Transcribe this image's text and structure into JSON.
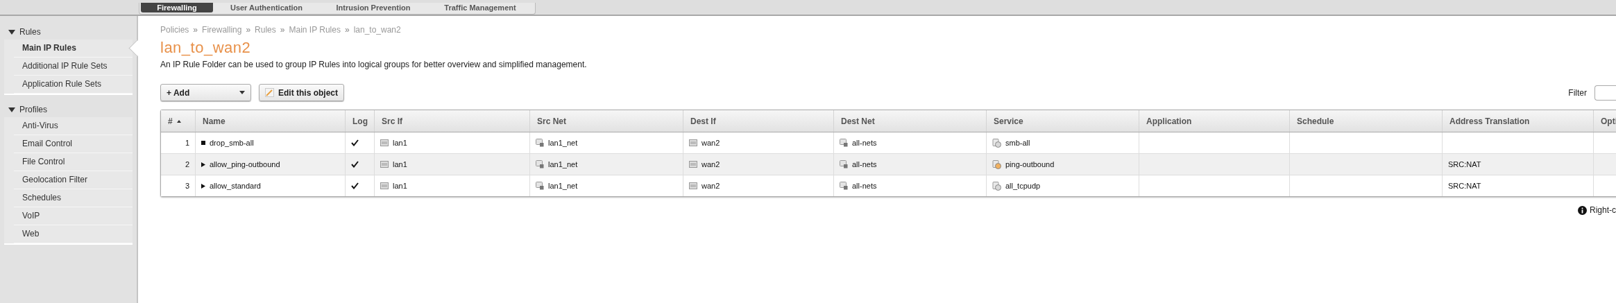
{
  "top_tabs": [
    {
      "label": "Firewalling",
      "selected": true
    },
    {
      "label": "User Authentication",
      "selected": false
    },
    {
      "label": "Intrusion Prevention",
      "selected": false
    },
    {
      "label": "Traffic Management",
      "selected": false
    }
  ],
  "sidebar": {
    "sections": [
      {
        "title": "Rules",
        "expanded": true,
        "items": [
          {
            "label": "Main IP Rules",
            "selected": true
          },
          {
            "label": "Additional IP Rule Sets",
            "selected": false
          },
          {
            "label": "Application Rule Sets",
            "selected": false
          }
        ]
      },
      {
        "title": "Profiles",
        "expanded": true,
        "items": [
          {
            "label": "Anti-Virus",
            "selected": false
          },
          {
            "label": "Email Control",
            "selected": false
          },
          {
            "label": "File Control",
            "selected": false
          },
          {
            "label": "Geolocation Filter",
            "selected": false
          },
          {
            "label": "Schedules",
            "selected": false
          },
          {
            "label": "VoIP",
            "selected": false
          },
          {
            "label": "Web",
            "selected": false
          }
        ]
      }
    ]
  },
  "breadcrumb": [
    "Policies",
    "Firewalling",
    "Rules",
    "Main IP Rules",
    "lan_to_wan2"
  ],
  "breadcrumb_separator": "»",
  "title": "lan_to_wan2",
  "description": "An IP Rule Folder can be used to group IP Rules into logical groups for better overview and simplified management.",
  "toolbar": {
    "add_button": "+ Add",
    "edit_button": "Edit this object",
    "filter_label": "Filter"
  },
  "table": {
    "columns": [
      {
        "label": "#",
        "sorted": true
      },
      {
        "label": "Name",
        "sorted": false
      },
      {
        "label": "Log",
        "sorted": false
      },
      {
        "label": "Src If",
        "sorted": false
      },
      {
        "label": "Src Net",
        "sorted": false
      },
      {
        "label": "Dest If",
        "sorted": false
      },
      {
        "label": "Dest Net",
        "sorted": false
      },
      {
        "label": "Service",
        "sorted": false
      },
      {
        "label": "Application",
        "sorted": false
      },
      {
        "label": "Schedule",
        "sorted": false
      },
      {
        "label": "Address Translation",
        "sorted": false
      },
      {
        "label": "Opti"
      }
    ],
    "rows": [
      {
        "number": "1",
        "name": {
          "text": "drop_smb-all",
          "kind": "drop"
        },
        "log": true,
        "src_if": "lan1",
        "src_net": "lan1_net",
        "dest_if": "wan2",
        "dest_net": "all-nets",
        "service": {
          "text": "smb-all",
          "kind": "group"
        }
      },
      {
        "number": "2",
        "name": {
          "text": "allow_ping-outbound",
          "kind": "allow"
        },
        "log": true,
        "src_if": "lan1",
        "src_net": "lan1_net",
        "dest_if": "wan2",
        "dest_net": "all-nets",
        "service": {
          "text": "ping-outbound",
          "kind": "icmp"
        },
        "address_translation": "SRC:NAT"
      },
      {
        "number": "3",
        "name": {
          "text": "allow_standard",
          "kind": "allow"
        },
        "log": true,
        "src_if": "lan1",
        "src_net": "lan1_net",
        "dest_if": "wan2",
        "dest_net": "all-nets",
        "service": {
          "text": "all_tcpudp",
          "kind": "group"
        },
        "address_translation": "SRC:NAT"
      }
    ]
  },
  "hint": "Right-c"
}
